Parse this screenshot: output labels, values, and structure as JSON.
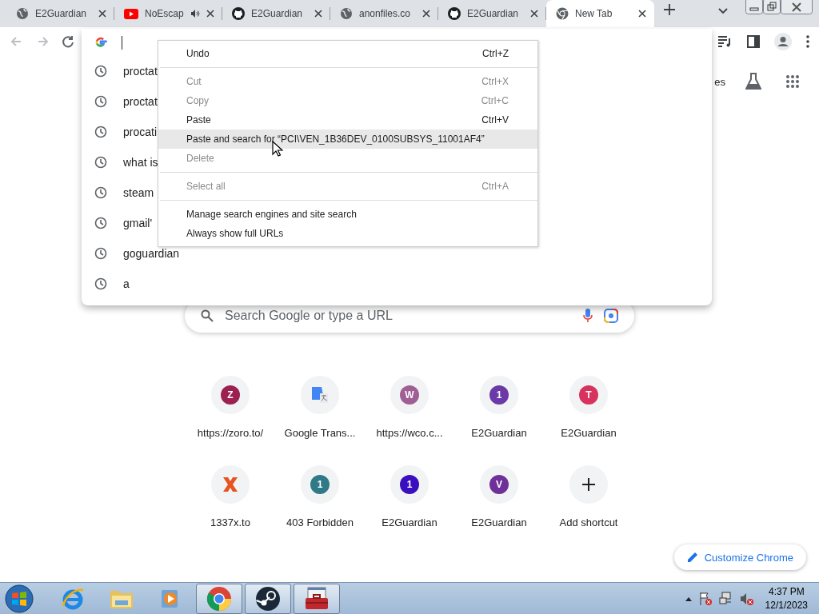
{
  "tabs": [
    {
      "title": "E2Guardian",
      "kind": "globe",
      "audio": false,
      "selected": false
    },
    {
      "title": "NoEscap",
      "kind": "video",
      "audio": true,
      "selected": false
    },
    {
      "title": "E2Guardian",
      "kind": "cat",
      "audio": false,
      "selected": false
    },
    {
      "title": "anonfiles.co",
      "kind": "globe",
      "audio": false,
      "selected": false
    },
    {
      "title": "E2Guardian",
      "kind": "cat",
      "audio": false,
      "selected": false
    },
    {
      "title": "New Tab",
      "kind": "browser",
      "audio": false,
      "selected": true
    }
  ],
  "toolbar": {
    "nav": [
      {
        "kind": "back",
        "disabled": true
      },
      {
        "kind": "forward",
        "disabled": true
      },
      {
        "kind": "reload",
        "disabled": false
      }
    ]
  },
  "omnibox": {
    "suggestions": [
      "proctat",
      "proctat",
      "procati",
      "what is",
      "steam",
      "gmail'",
      "goguardian",
      "a"
    ]
  },
  "context_menu": {
    "groups": [
      [
        {
          "label": "Undo",
          "shortcut": "Ctrl+Z",
          "disabled": false,
          "selected": false
        }
      ],
      [
        {
          "label": "Cut",
          "shortcut": "Ctrl+X",
          "disabled": true,
          "selected": false
        },
        {
          "label": "Copy",
          "shortcut": "Ctrl+C",
          "disabled": true,
          "selected": false
        },
        {
          "label": "Paste",
          "shortcut": "Ctrl+V",
          "disabled": false,
          "selected": false
        },
        {
          "label": "Paste and search for “PCI\\VEN_1B36DEV_0100SUBSYS_11001AF4”",
          "disabled": false,
          "selected": true
        },
        {
          "label": "Delete",
          "disabled": true,
          "selected": false
        }
      ],
      [
        {
          "label": "Select all",
          "shortcut": "Ctrl+A",
          "disabled": true,
          "selected": false
        }
      ],
      [
        {
          "label": "Manage search engines and site search",
          "disabled": false,
          "selected": false
        },
        {
          "label": "Always show full URLs",
          "disabled": false,
          "selected": false
        }
      ]
    ]
  },
  "new_tab_page": {
    "header_link": "es",
    "search": {
      "placeholder": "Search Google or type a URL"
    },
    "shortcuts": [
      {
        "kind": "letter",
        "letter": "Z",
        "color": "#9c2150",
        "label": "https://zoro.to/"
      },
      {
        "kind": "translate",
        "label": "Google Trans..."
      },
      {
        "kind": "letter",
        "letter": "W",
        "color": "#a05f94",
        "label": "https://wco.c..."
      },
      {
        "kind": "letter",
        "letter": "1",
        "color": "#6b3aa8",
        "label": "E2Guardian"
      },
      {
        "kind": "letter",
        "letter": "T",
        "color": "#d8325e",
        "label": "E2Guardian"
      },
      {
        "kind": "x",
        "label": "1337x.to"
      },
      {
        "kind": "letter",
        "letter": "1",
        "color": "#2f7a86",
        "label": "403 Forbidden"
      },
      {
        "kind": "letter",
        "letter": "1",
        "color": "#3a0fbf",
        "label": "E2Guardian"
      },
      {
        "kind": "letter",
        "letter": "V",
        "color": "#70309a",
        "label": "E2Guardian"
      },
      {
        "kind": "add",
        "label": "Add shortcut"
      }
    ],
    "customize_button": "Customize Chrome"
  },
  "taskbar": {
    "apps": [
      {
        "kind": "ie",
        "active": false
      },
      {
        "kind": "explorer",
        "active": false
      },
      {
        "kind": "media",
        "active": false
      },
      {
        "kind": "chrome",
        "active": true
      },
      {
        "kind": "steam",
        "active": true
      },
      {
        "kind": "toolbox",
        "active": true
      }
    ],
    "time": "4:37 PM",
    "date": "12/1/2023"
  }
}
